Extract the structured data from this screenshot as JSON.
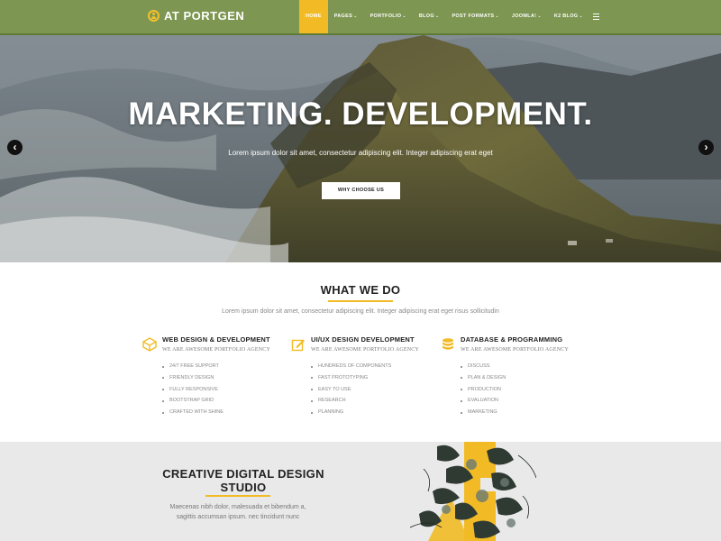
{
  "brand": {
    "name": "AT PORTGEN",
    "icon": "user-circle-icon"
  },
  "nav": {
    "items": [
      {
        "label": "HOME",
        "caret": ""
      },
      {
        "label": "PAGES",
        "caret": "⌄"
      },
      {
        "label": "PORTFOLIO",
        "caret": "⌄"
      },
      {
        "label": "BLOG",
        "caret": "⌄"
      },
      {
        "label": "POST FORMATS",
        "caret": "⌄"
      },
      {
        "label": "JOOMLA!",
        "caret": "⌄"
      },
      {
        "label": "K2 BLOG",
        "caret": "⌄"
      }
    ],
    "active_index": 0
  },
  "hero": {
    "title": "MARKETING. DEVELOPMENT.",
    "subtitle": "Lorem ipsum dolor sit amet, consectetur adipiscing elit. Integer adipiscing erat eget",
    "button_label": "WHY CHOOSE US",
    "prev_arrow": "‹",
    "next_arrow": "›"
  },
  "services": {
    "title": "WHAT WE DO",
    "description": "Lorem ipsum dolor sit amet, consectetur adipiscing elit. Integer adipiscing erat eget risus sollicitudin",
    "columns": [
      {
        "icon": "cube-icon",
        "heading": "WEB DESIGN & DEVELOPMENT",
        "tagline": "WE ARE AWESOME PORTFOLIO AGENCY",
        "items": [
          "24/7 FREE SUPPORT",
          "FRIENDLY DESIGN",
          "FULLY RESPONSIVE",
          "BOOTSTRAP GRID",
          "CRAFTED WITH SHINE"
        ]
      },
      {
        "icon": "pencil-square-icon",
        "heading": "UI/UX DESIGN DEVELOPMENT",
        "tagline": "WE ARE AWESOME PORTFOLIO AGENCY",
        "items": [
          "HUNDREDS OF COMPONENTS",
          "FAST PROTOTYPING",
          "EASY TO USE",
          "RESEARCH",
          "PLANNING"
        ]
      },
      {
        "icon": "database-icon",
        "heading": "DATABASE & PROGRAMMING",
        "tagline": "WE ARE AWESOME PORTFOLIO AGENCY",
        "items": [
          "DISCUSS",
          "PLAN & DESIGN",
          "PRODUCTION",
          "EVALUATION",
          "MARKETING"
        ]
      }
    ]
  },
  "studio": {
    "title": "CREATIVE DIGITAL DESIGN STUDIO",
    "text": "Maecenas nibh dolor, malesuada et bibendum a, sagittis accumsan ipsum. nec tincidunt nunc"
  },
  "colors": {
    "nav_bg": "#7d9651",
    "accent": "#f2bb26",
    "section_bg": "#e9e9e9"
  }
}
